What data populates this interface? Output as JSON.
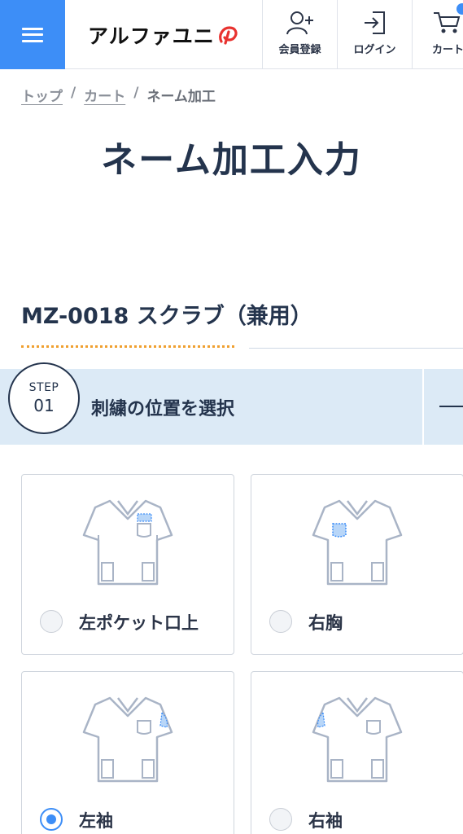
{
  "header": {
    "logo_text": "アルファユニ",
    "member_label": "会員登録",
    "login_label": "ログイン",
    "cart_label": "カート"
  },
  "breadcrumb": {
    "items": [
      "トップ",
      "カート"
    ],
    "current": "ネーム加工"
  },
  "page_title": "ネーム加工入力",
  "product_title": "MZ-0018 スクラブ（兼用）",
  "step": {
    "prefix": "STEP",
    "number": "01",
    "label": "刺繍の位置を選択"
  },
  "options": [
    {
      "label": "左ポケット口上",
      "selected": false,
      "icon": "scrub-shirt-left-pocket-top-icon"
    },
    {
      "label": "右胸",
      "selected": false,
      "icon": "scrub-shirt-right-chest-icon"
    },
    {
      "label": "左袖",
      "selected": true,
      "icon": "scrub-shirt-left-sleeve-icon"
    },
    {
      "label": "右袖",
      "selected": false,
      "icon": "scrub-shirt-right-sleeve-icon"
    }
  ],
  "colors": {
    "accent": "#3d8ef7",
    "navy": "#24344d",
    "step_bar": "#dceaf6",
    "dotted_orange": "#f0a030"
  }
}
